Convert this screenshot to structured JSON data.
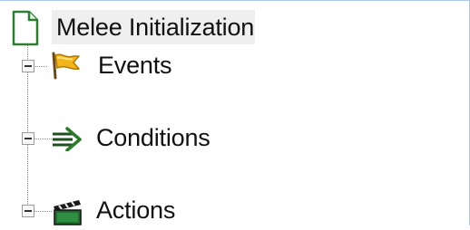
{
  "tree": {
    "root": {
      "label": "Melee Initialization",
      "icon": "document-icon"
    },
    "nodes": [
      {
        "label": "Events",
        "icon": "flag-icon",
        "expanded": true
      },
      {
        "label": "Conditions",
        "icon": "arrow-icon",
        "expanded": true
      },
      {
        "label": "Actions",
        "icon": "clapperboard-icon",
        "expanded": true
      }
    ]
  },
  "colors": {
    "panel_border": "#a9c8ea",
    "selection_bg": "#efefef",
    "flag_yellow": "#f2b41c",
    "arrow_green": "#2a7a2a",
    "clapper_green": "#1f6b2e"
  }
}
